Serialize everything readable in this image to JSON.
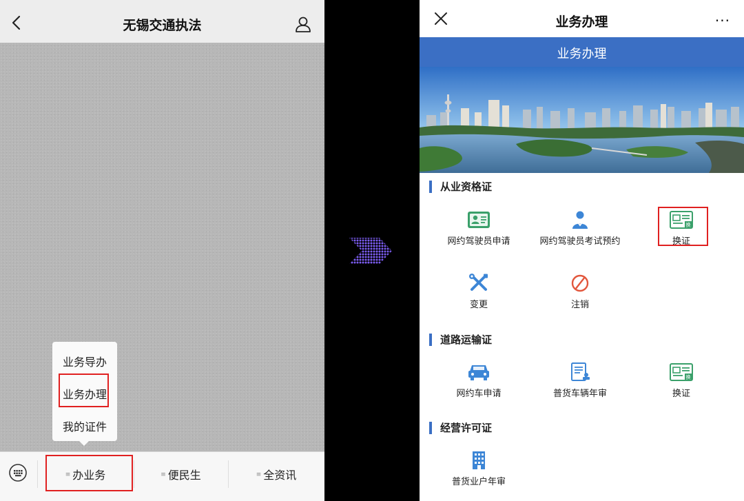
{
  "left_phone": {
    "title": "无锡交通执法",
    "submenu": [
      "业务导办",
      "业务办理",
      "我的证件"
    ],
    "tabs": [
      "办业务",
      "便民生",
      "全资讯"
    ]
  },
  "right_phone": {
    "title": "业务办理",
    "banner_title": "业务办理",
    "more_label": "···",
    "sections": [
      {
        "title": "从业资格证",
        "items": [
          "网约驾驶员申请",
          "网约驾驶员考试预约",
          "换证",
          "变更",
          "注销"
        ]
      },
      {
        "title": "道路运输证",
        "items": [
          "网约车申请",
          "普货车辆年审",
          "换证"
        ]
      },
      {
        "title": "经营许可证",
        "items": [
          "普货业户年审"
        ]
      }
    ]
  },
  "colors": {
    "accent_blue": "#3b6fc4",
    "highlight_red": "#e02020",
    "green_icon": "#3aa06a"
  }
}
